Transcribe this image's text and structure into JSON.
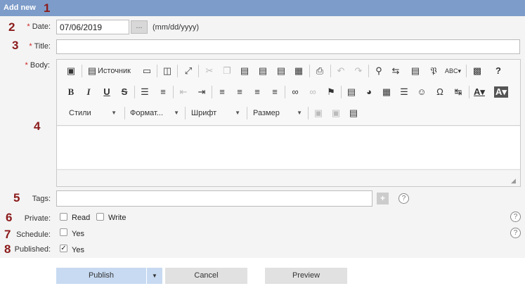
{
  "header": {
    "title": "Add new"
  },
  "markers": [
    "1",
    "2",
    "3",
    "4",
    "5",
    "6",
    "7",
    "8"
  ],
  "form": {
    "required_mark": "*",
    "date": {
      "label": "Date:",
      "value": "07/06/2019",
      "picker_label": "...",
      "hint": "(mm/dd/yyyy)"
    },
    "title": {
      "label": "Title:",
      "value": ""
    },
    "body": {
      "label": "Body:"
    },
    "tags": {
      "label": "Tags:",
      "add_label": "+",
      "help": "?"
    },
    "private": {
      "label": "Private:",
      "read_label": "Read",
      "read_checked": false,
      "write_label": "Write",
      "write_checked": false,
      "help": "?"
    },
    "schedule": {
      "label": "Schedule:",
      "yes_label": "Yes",
      "checked": false,
      "help": "?"
    },
    "published": {
      "label": "Published:",
      "yes_label": "Yes",
      "checked": true
    }
  },
  "editor": {
    "source_label": "Источник",
    "styles_label": "Стили",
    "format_label": "Формат...",
    "font_label": "Шрифт",
    "size_label": "Размер",
    "help_label": "?"
  },
  "buttons": {
    "publish": "Publish",
    "cancel": "Cancel",
    "preview": "Preview"
  }
}
